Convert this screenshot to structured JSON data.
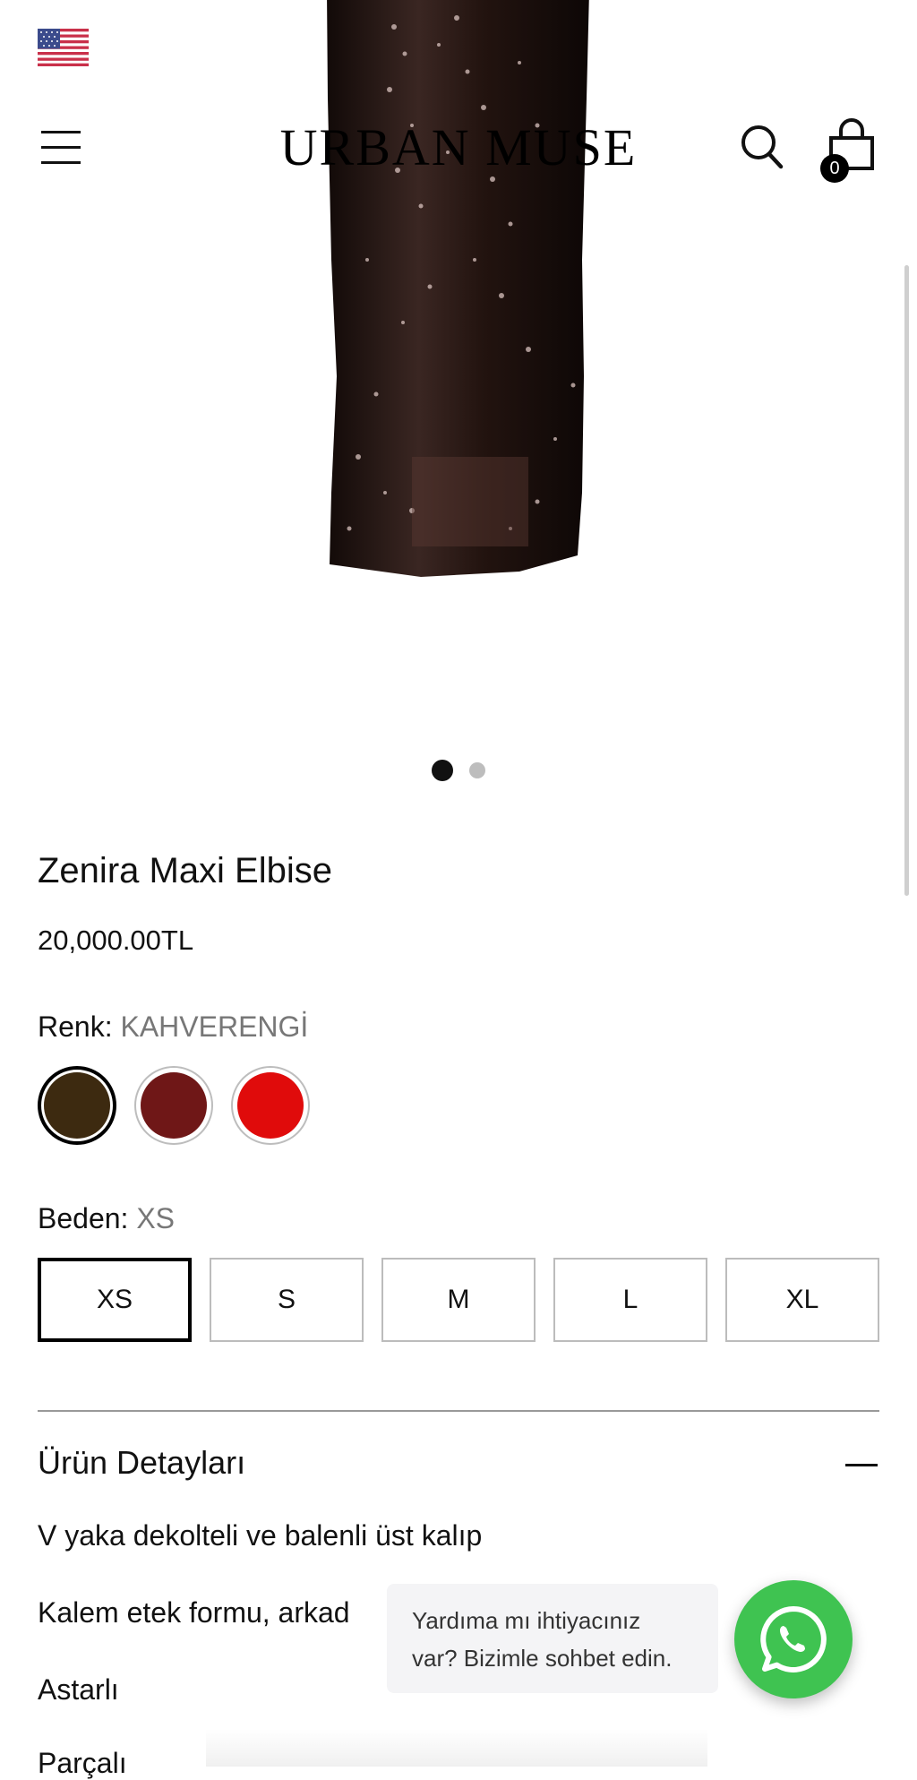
{
  "header": {
    "logo": "URBAN MUSE",
    "cart_count": "0",
    "icons": {
      "flag": "us-flag-icon",
      "menu": "hamburger-menu-icon",
      "search": "search-icon",
      "cart": "shopping-bag-icon"
    }
  },
  "gallery": {
    "slides_total": 2,
    "active_slide": 1
  },
  "product": {
    "title": "Zenira Maxi Elbise",
    "price": "20,000.00TL",
    "color_label": "Renk:",
    "color_value": "KAHVERENGİ",
    "colors": [
      {
        "hex": "#3d2a10",
        "selected": true
      },
      {
        "hex": "#6f1717",
        "selected": false
      },
      {
        "hex": "#e00b0b",
        "selected": false
      }
    ],
    "size_label": "Beden:",
    "size_value": "XS",
    "sizes": [
      "XS",
      "S",
      "M",
      "L",
      "XL"
    ]
  },
  "details": {
    "title": "Ürün Detayları",
    "lines": [
      "V yaka dekolteli ve balenli üst kalıp",
      "Kalem  etek formu, arkad",
      "Astarlı",
      "Parçalı"
    ]
  },
  "chat": {
    "message_line1": "Yardıma mı ihtiyacınız",
    "message_line2": "var? Bizimle sohbet edin.",
    "icon": "whatsapp-icon",
    "accent": "#3fc351"
  }
}
